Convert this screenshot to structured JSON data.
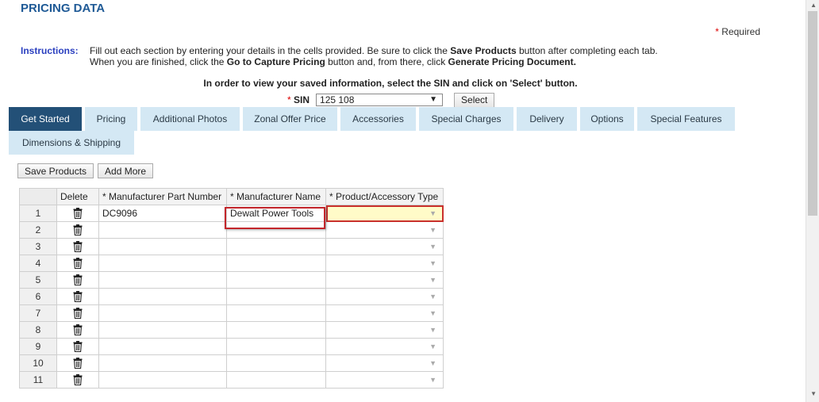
{
  "page": {
    "title": "PRICING DATA",
    "required_star": "*",
    "required_label": "Required"
  },
  "instructions": {
    "label": "Instructions:",
    "line1_a": "Fill out each section by entering your details in the cells provided. Be sure to click the ",
    "line1_b": "Save Products",
    "line1_c": " button after completing each tab.",
    "line2_a": "When you are finished, click the ",
    "line2_b": "Go to Capture Pricing",
    "line2_c": " button and, from there, click ",
    "line2_d": "Generate Pricing Document."
  },
  "view_note": "In order to view your saved information, select the SIN and click on 'Select' button.",
  "sin": {
    "star": "*",
    "label": "SIN",
    "value": "125 108",
    "select_label": "Select"
  },
  "tabs": [
    {
      "label": "Get Started",
      "active": true
    },
    {
      "label": "Pricing"
    },
    {
      "label": "Additional Photos"
    },
    {
      "label": "Zonal Offer Price"
    },
    {
      "label": "Accessories"
    },
    {
      "label": "Special Charges"
    },
    {
      "label": "Delivery"
    },
    {
      "label": "Options"
    },
    {
      "label": "Special Features"
    },
    {
      "label": "Dimensions & Shipping"
    }
  ],
  "toolbar": {
    "save_label": "Save Products",
    "add_label": "Add More"
  },
  "grid": {
    "headers": [
      "Delete",
      "* Manufacturer Part Number",
      "* Manufacturer Name",
      "* Product/Accessory Type"
    ],
    "rows": [
      {
        "num": "1",
        "part": "DC9096",
        "name": "Dewalt Power Tools",
        "type": ""
      },
      {
        "num": "2",
        "part": "",
        "name": "",
        "type": ""
      },
      {
        "num": "3",
        "part": "",
        "name": "",
        "type": ""
      },
      {
        "num": "4",
        "part": "",
        "name": "",
        "type": ""
      },
      {
        "num": "5",
        "part": "",
        "name": "",
        "type": ""
      },
      {
        "num": "6",
        "part": "",
        "name": "",
        "type": ""
      },
      {
        "num": "7",
        "part": "",
        "name": "",
        "type": ""
      },
      {
        "num": "8",
        "part": "",
        "name": "",
        "type": ""
      },
      {
        "num": "9",
        "part": "",
        "name": "",
        "type": ""
      },
      {
        "num": "10",
        "part": "",
        "name": "",
        "type": ""
      },
      {
        "num": "11",
        "part": "",
        "name": "",
        "type": ""
      }
    ]
  },
  "colors": {
    "title": "#1f5a96",
    "tab_active": "#235077",
    "tab_inactive": "#d4e8f4",
    "highlight_border": "#c3262b",
    "highlight_fill": "#fffbc8"
  },
  "icons": {
    "delete": "trash-icon",
    "dropdown": "chevron-down-icon"
  }
}
